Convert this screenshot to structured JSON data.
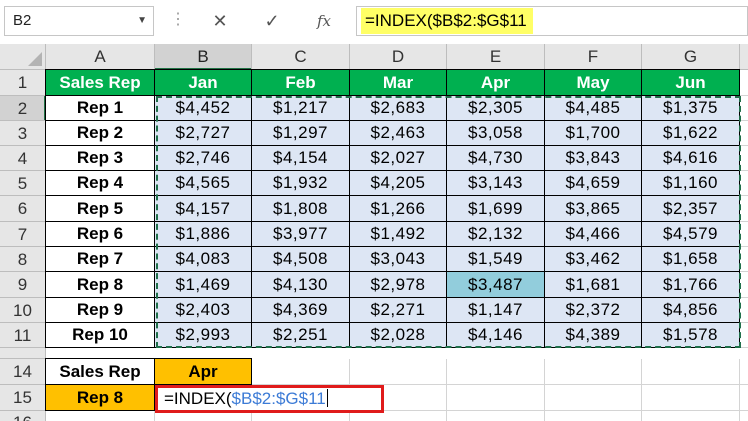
{
  "formula_bar": {
    "name_box": "B2",
    "name_box_dropdown": "▼",
    "separator": "⋮",
    "cancel_label": "✕",
    "enter_label": "✓",
    "fx_label": "fx",
    "formula": "=INDEX($B$2:$G$11"
  },
  "columns": [
    "A",
    "B",
    "C",
    "D",
    "E",
    "F",
    "G"
  ],
  "rows": [
    "1",
    "2",
    "3",
    "4",
    "5",
    "6",
    "7",
    "8",
    "9",
    "10",
    "11",
    "14",
    "15",
    "16"
  ],
  "table": {
    "header": [
      "Sales Rep",
      "Jan",
      "Feb",
      "Mar",
      "Apr",
      "May",
      "Jun"
    ],
    "body": [
      [
        "Rep 1",
        "$4,452",
        "$1,217",
        "$2,683",
        "$2,305",
        "$4,485",
        "$1,375"
      ],
      [
        "Rep 2",
        "$2,727",
        "$1,297",
        "$2,463",
        "$3,058",
        "$1,700",
        "$1,622"
      ],
      [
        "Rep 3",
        "$2,746",
        "$4,154",
        "$2,027",
        "$4,730",
        "$3,843",
        "$4,616"
      ],
      [
        "Rep 4",
        "$4,565",
        "$1,932",
        "$4,205",
        "$3,143",
        "$4,659",
        "$1,160"
      ],
      [
        "Rep 5",
        "$4,157",
        "$1,808",
        "$1,266",
        "$1,699",
        "$3,865",
        "$2,357"
      ],
      [
        "Rep 6",
        "$1,886",
        "$3,977",
        "$1,492",
        "$2,132",
        "$4,466",
        "$4,579"
      ],
      [
        "Rep 7",
        "$4,083",
        "$4,508",
        "$3,043",
        "$1,549",
        "$3,462",
        "$1,658"
      ],
      [
        "Rep 8",
        "$1,469",
        "$4,130",
        "$2,978",
        "$3,487",
        "$1,681",
        "$1,766"
      ],
      [
        "Rep 9",
        "$2,403",
        "$4,369",
        "$2,271",
        "$1,147",
        "$2,372",
        "$4,856"
      ],
      [
        "Rep 10",
        "$2,993",
        "$2,251",
        "$2,028",
        "$4,146",
        "$4,389",
        "$1,578"
      ]
    ]
  },
  "lookup": {
    "label_header": "Sales Rep",
    "month_header": "Apr",
    "rep_value": "Rep 8",
    "edit_prefix": "=INDEX(",
    "edit_ref": "$B$2:$G$11"
  },
  "colors": {
    "header_green": "#00b050",
    "range_fill": "#dde6f4",
    "match_fill": "#92cddc",
    "lookup_orange": "#ffc000",
    "formula_highlight": "#ffff66",
    "edit_border": "#e01b1b",
    "reference_blue": "#3c7bd6"
  }
}
